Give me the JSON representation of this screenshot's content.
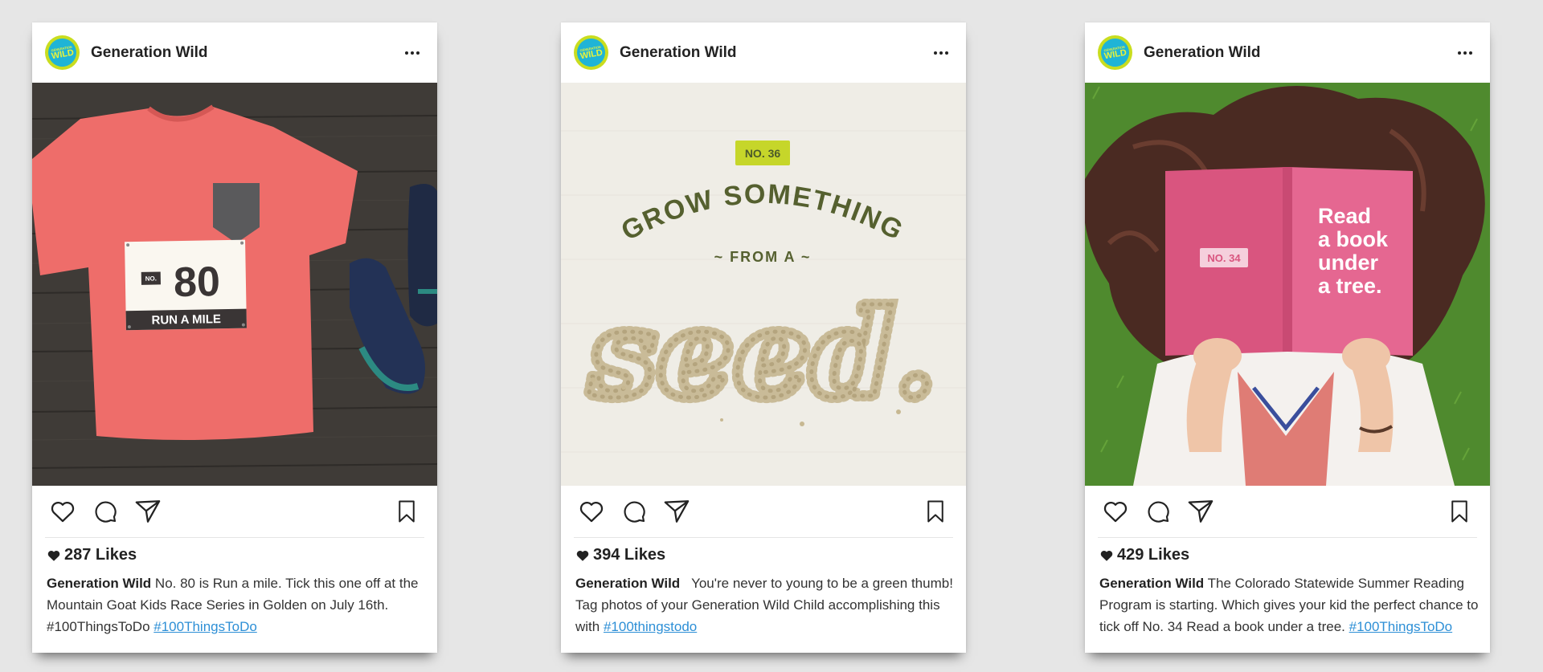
{
  "colors": {
    "background": "#e6e6e6",
    "link": "#2d8fd6",
    "avatar_outer": "#c9dd1f",
    "avatar_inner": "#1fb4d6"
  },
  "icons": {
    "like": "heart-outline-icon",
    "comment": "speech-bubble-icon",
    "share": "paper-plane-icon",
    "save": "bookmark-icon",
    "more": "three-dots-icon",
    "likes_heart": "heart-filled-icon"
  },
  "posts": [
    {
      "account": {
        "name": "Generation Wild",
        "avatar_text": [
          "GENERATION",
          "WILD"
        ]
      },
      "image": {
        "badge_no": "NO.",
        "badge_number": "80",
        "badge_label": "RUN A MILE"
      },
      "likes": "287 Likes",
      "caption": {
        "author": "Generation Wild",
        "text": " No. 80 is Run a mile. Tick this one off at the Mountain Goat Kids Race Series in Golden on July 16th.  #100ThingsToDo ",
        "hashtag": "#100ThingsToDo"
      }
    },
    {
      "account": {
        "name": "Generation Wild",
        "avatar_text": [
          "GENERATION",
          "WILD"
        ]
      },
      "image": {
        "badge": "NO. 36",
        "line1": "GROW SOMETHING",
        "line2": "~ FROM A ~",
        "line3": "seed."
      },
      "likes": "394 Likes",
      "caption": {
        "author": "Generation Wild",
        "text": "   You're never to young to be a green thumb! Tag photos of your Generation Wild Child accomplishing this with ",
        "hashtag": "#100thingstodo"
      }
    },
    {
      "account": {
        "name": "Generation Wild",
        "avatar_text": [
          "GENERATION",
          "WILD"
        ]
      },
      "image": {
        "badge": "NO. 34",
        "book_lines": [
          "Read",
          "a book",
          "under",
          "a tree."
        ]
      },
      "likes": "429 Likes",
      "caption": {
        "author": "Generation Wild",
        "text": " The Colorado Statewide Summer Reading Program is starting. Which gives your kid the perfect chance to tick off No. 34 Read a book under a tree. ",
        "hashtag": "#100ThingsToDo"
      }
    }
  ]
}
